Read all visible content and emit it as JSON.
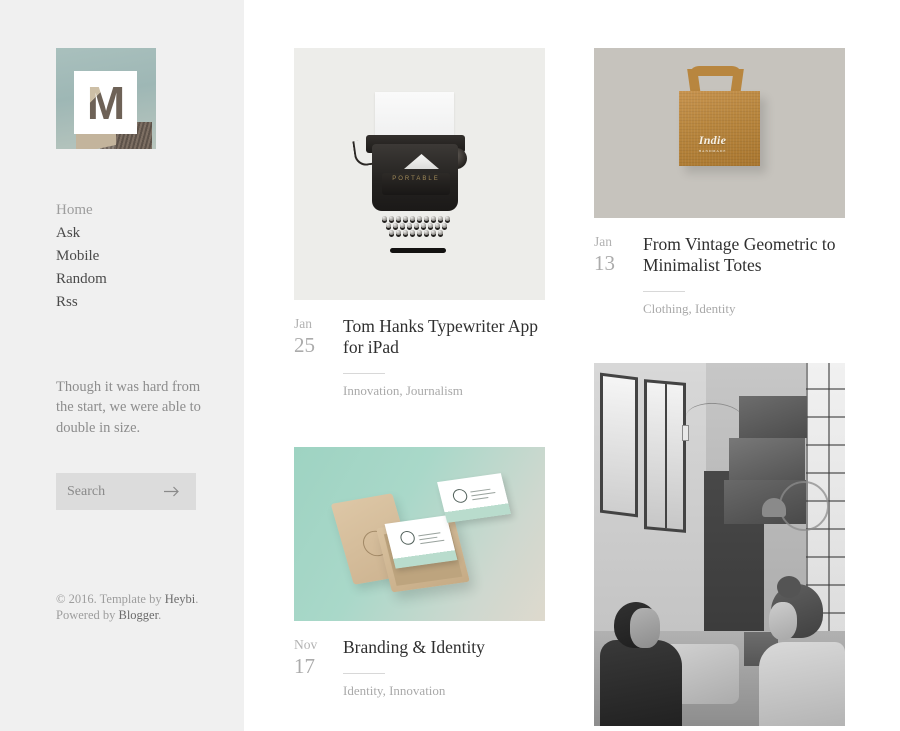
{
  "sidebar": {
    "logo": {
      "icon": "logo-m-monogram",
      "letter": "M",
      "alt": "M monogram over architecture photo"
    },
    "nav": [
      {
        "label": "Home",
        "active": true
      },
      {
        "label": "Ask",
        "active": false
      },
      {
        "label": "Mobile",
        "active": false
      },
      {
        "label": "Random",
        "active": false
      },
      {
        "label": "Rss",
        "active": false
      }
    ],
    "description": "Though it was hard from the start, we were able to double in size.",
    "search": {
      "placeholder": "Search",
      "value": "",
      "submit_icon": "arrow-right-icon"
    },
    "footer": {
      "copyright": "© 2016. Template by ",
      "template_link": "Heybi",
      "copyright_end": ".",
      "powered_prefix": "Powered by ",
      "powered_link": "Blogger",
      "powered_end": "."
    }
  },
  "posts": [
    {
      "id": "typewriter",
      "month": "Jan",
      "day": "25",
      "title": "Tom Hanks Typewriter App for iPad",
      "tags": "Innovation, Journalism",
      "image_alt": "Vintage black typewriter with blank paper on light background",
      "image_bg": "#ededea"
    },
    {
      "id": "totes",
      "month": "Jan",
      "day": "13",
      "title": "From Vintage Geometric to Minimalist Totes",
      "tags": "Clothing, Identity",
      "image_alt": "Jute tote bag with Indie script logo on warm gray background",
      "image_bg": "#c6c3bd",
      "image_text": "Indie",
      "image_subtext": "HANDMADE"
    },
    {
      "id": "branding",
      "month": "Nov",
      "day": "17",
      "title": "Branding & Identity",
      "tags": "Identity, Innovation",
      "image_alt": "Kraft box with white business cards on mint green background",
      "image_bg": "#9ed3c2"
    },
    {
      "id": "couple",
      "month": "",
      "day": "",
      "title": "",
      "tags": "",
      "image_alt": "Black and white photo of a couple sitting on a couch with moving boxes",
      "image_bg": "#cfcdc9"
    }
  ],
  "colors": {
    "sidebar_bg": "#f0f0f0",
    "page_bg": "#ffffff",
    "text_dark": "#2f2f2f",
    "text_nav": "#4a4a4a",
    "text_muted": "#9d9d9d",
    "date_gray": "#b2b2b2",
    "tag_gray": "#a9a9a9",
    "search_bg": "#dcdcdc",
    "divider": "#d8d8d8"
  }
}
